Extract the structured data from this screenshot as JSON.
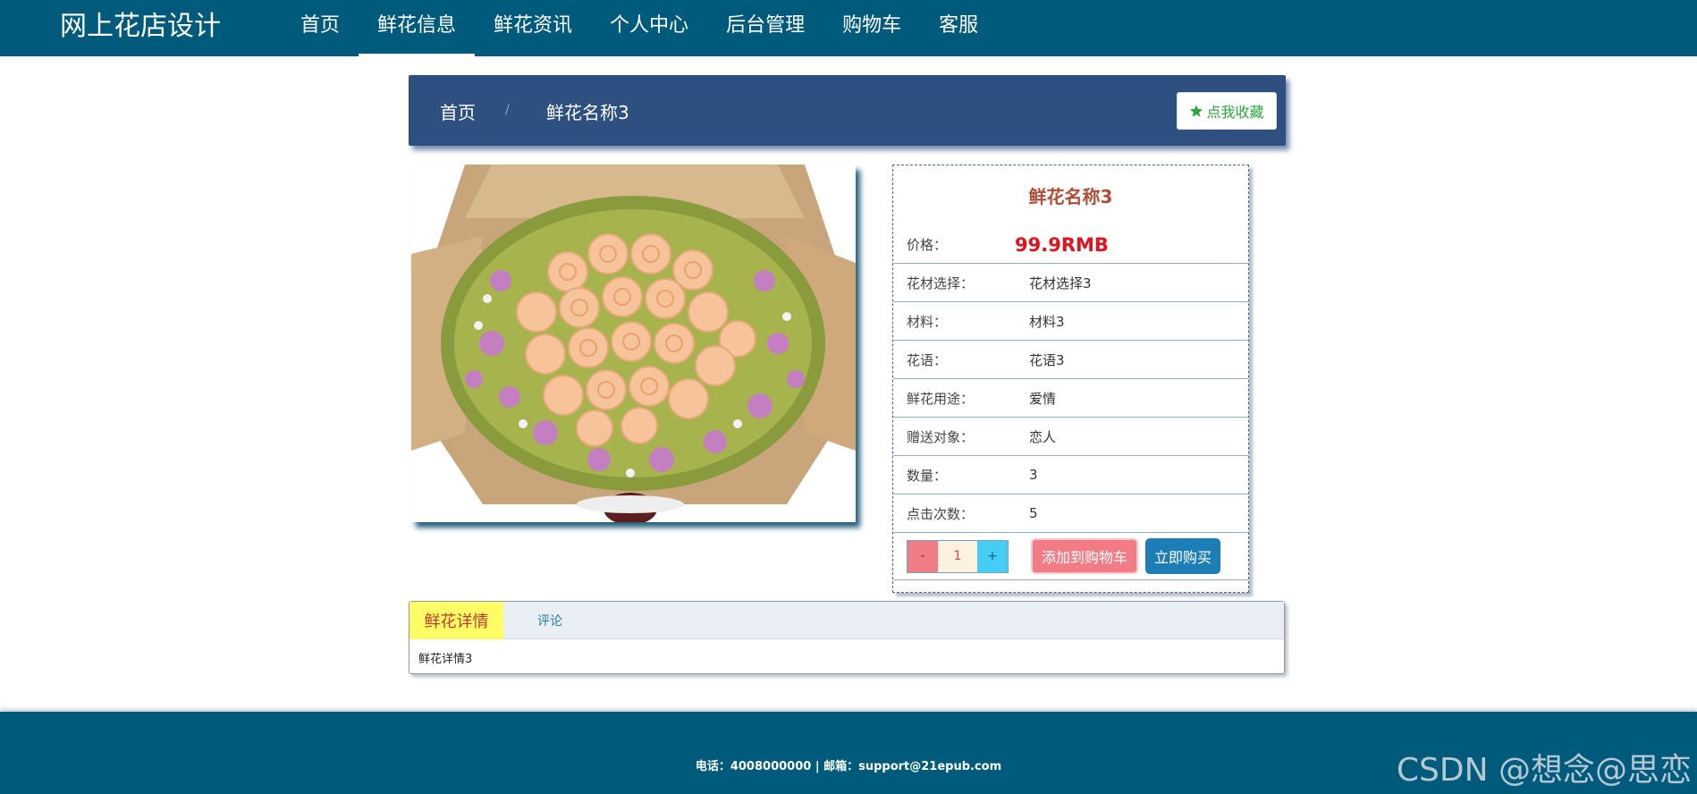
{
  "header": {
    "brand": "网上花店设计",
    "nav": [
      "首页",
      "鲜花信息",
      "鲜花资讯",
      "个人中心",
      "后台管理",
      "购物车",
      "客服"
    ],
    "active_nav": "鲜花信息"
  },
  "breadcrumb": {
    "home": "首页",
    "separator": "/",
    "current": "鲜花名称3",
    "favorite_label": "点我收藏"
  },
  "product": {
    "title": "鲜花名称3",
    "price_label": "价格：",
    "price": "99.9RMB",
    "rows": [
      {
        "label": "花材选择：",
        "value": "花材选择3"
      },
      {
        "label": "材料：",
        "value": "材料3"
      },
      {
        "label": "花语：",
        "value": "花语3"
      },
      {
        "label": "鲜花用途：",
        "value": "爱情"
      },
      {
        "label": "赠送对象：",
        "value": "恋人"
      },
      {
        "label": "数量：",
        "value": "3"
      },
      {
        "label": "点击次数：",
        "value": "5"
      }
    ],
    "qty_minus": "-",
    "qty_value": "1",
    "qty_plus": "+",
    "add_to_cart": "添加到购物车",
    "buy_now": "立即购买"
  },
  "tabs": {
    "detail_tab": "鲜花详情",
    "comment_tab": "评论",
    "detail_body": "鲜花详情3"
  },
  "footer": {
    "contact": "电话：4008000000 | 邮箱：support@21epub.com",
    "watermark": "CSDN @想念@思恋"
  },
  "colors": {
    "header_bg": "#005a7c",
    "breadcrumb_bg": "#2e5080",
    "price": "#e0121e",
    "title": "#b04d36",
    "cart_button": "#f27c85",
    "buy_button": "#1d7db5"
  }
}
